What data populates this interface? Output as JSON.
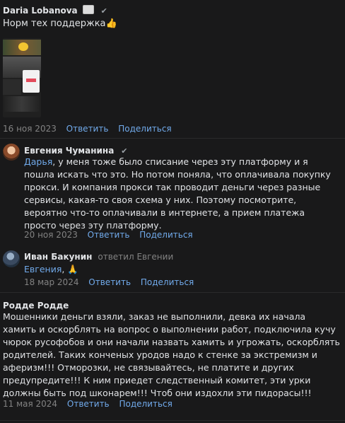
{
  "comments": [
    {
      "author": "Daria Lobanova",
      "text": "Норм тех поддержка",
      "date": "16 ноя 2023",
      "reply": "Ответить",
      "share": "Поделиться"
    },
    {
      "author": "Евгения Чуманина",
      "mention": "Дарья",
      "text": ", у меня тоже было списание через эту платформу и я пошла искать что это. Но потом поняла, что оплачивала покупку прокси. И компания прокси так проводит деньги через разные сервисы, какая-то своя схема у них. Поэтому посмотрите, вероятно что-то оплачивали в интернете, а прием платежа просто через эту платформу.",
      "date": "20 ноя 2023",
      "reply": "Ответить",
      "share": "Поделиться"
    },
    {
      "author": "Иван Бакунин",
      "replied_to": "ответил Евгении",
      "mention": "Евгения",
      "text": ", 🙏",
      "date": "18 мар 2024",
      "reply": "Ответить",
      "share": "Поделиться"
    },
    {
      "author": "Родде Родде",
      "text": "Мошенники деньги взяли, заказ не выполнили, девка их начала хамить и оскорблять на вопрос о выполнении работ, подключила кучу чюрок русофобов и они начали назвать хамить и угрожать, оскорблять родителей. Таких конченых уродов надо к стенке за экстремизм и аферизм!!! Отморозки, не связывайтесь, не платите и других предупредите!!! К ним приедет следственный комитет, эти урки должны быть под шконарем!!! Чтоб они издохли эти пидорасы!!!",
      "date": "11 мая 2024",
      "reply": "Ответить",
      "share": "Поделиться"
    }
  ]
}
